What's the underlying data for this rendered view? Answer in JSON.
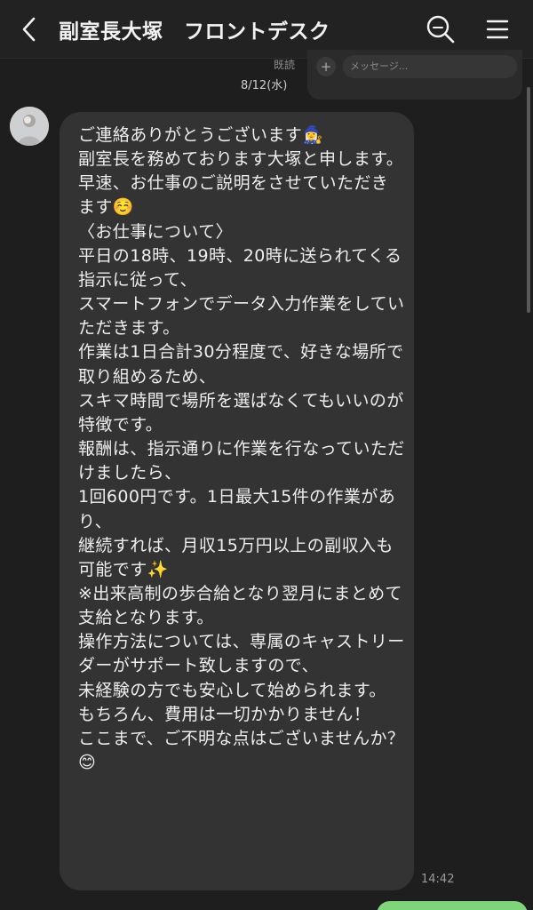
{
  "header": {
    "title": "副室長大塚　フロントデスク",
    "back_icon": "chevron-left-icon",
    "search_icon": "search-icon",
    "menu_icon": "hamburger-menu-icon"
  },
  "previous_message": {
    "read_label": "既読",
    "input_placeholder": "メッセージ..."
  },
  "chat": {
    "date": "8/12(水)",
    "message": {
      "text": "ご連絡ありがとうございます🧙‍♀️\n副室長を務めております大塚と申します。\n早速、お仕事のご説明をさせていただきます☺️\n〈お仕事について〉\n平日の18時、19時、20時に送られてくる指示に従って、\nスマートフォンでデータ入力作業をしていただきます。\n作業は1日合計30分程度で、好きな場所で取り組めるため、\nスキマ時間で場所を選ばなくてもいいのが特徴です。\n報酬は、指示通りに作業を行なっていただけましたら、\n1回600円です。1日最大15件の作業があり、\n継続すれば、月収15万円以上の副収入も可能です✨\n※出来高制の歩合給となり翌月にまとめて支給となります。\n操作方法については、専属のキャストリーダーがサポート致しますので、\n未経験の方でも安心して始められます。\nもちろん、費用は一切かかりません！\nここまで、ご不明な点はございませんか？😊",
      "time": "14:42"
    }
  },
  "colors": {
    "background": "#1e1e1e",
    "bubble": "#333333",
    "header": "#222222",
    "accent_green": "#7fd67a"
  }
}
